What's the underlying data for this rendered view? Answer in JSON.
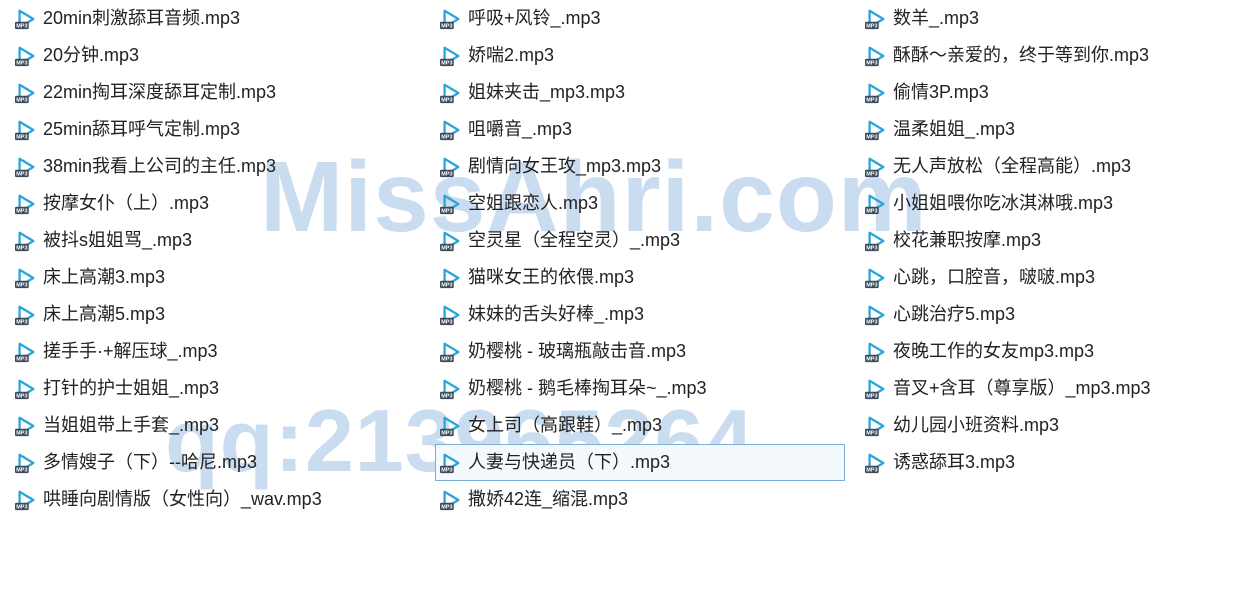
{
  "watermark": {
    "line1": "MissAhri.com",
    "line2": "qq:213965264"
  },
  "selected_name": "人妻与快递员（下）.mp3",
  "columns": [
    {
      "items": [
        {
          "name": "20min刺激舔耳音频.mp3"
        },
        {
          "name": "20分钟.mp3"
        },
        {
          "name": "22min掏耳深度舔耳定制.mp3"
        },
        {
          "name": "25min舔耳呼气定制.mp3"
        },
        {
          "name": "38min我看上公司的主任.mp3"
        },
        {
          "name": "按摩女仆（上）.mp3"
        },
        {
          "name": "被抖s姐姐骂_.mp3"
        },
        {
          "name": "床上高潮3.mp3"
        },
        {
          "name": "床上高潮5.mp3"
        },
        {
          "name": "搓手手·+解压球_.mp3"
        },
        {
          "name": "打针的护士姐姐_.mp3"
        },
        {
          "name": "当姐姐带上手套_.mp3"
        },
        {
          "name": "多情嫂子（下）--哈尼.mp3"
        },
        {
          "name": "哄睡向剧情版（女性向）_wav.mp3"
        }
      ]
    },
    {
      "items": [
        {
          "name": "呼吸+风铃_.mp3"
        },
        {
          "name": "娇喘2.mp3"
        },
        {
          "name": "姐妹夹击_mp3.mp3"
        },
        {
          "name": "咀嚼音_.mp3"
        },
        {
          "name": "剧情向女王攻_mp3.mp3"
        },
        {
          "name": "空姐跟恋人.mp3"
        },
        {
          "name": "空灵星（全程空灵）_.mp3"
        },
        {
          "name": "猫咪女王的依偎.mp3"
        },
        {
          "name": "妹妹的舌头好棒_.mp3"
        },
        {
          "name": "奶樱桃 - 玻璃瓶敲击音.mp3"
        },
        {
          "name": "奶樱桃 - 鹅毛棒掏耳朵~_.mp3"
        },
        {
          "name": "女上司（高跟鞋）_.mp3"
        },
        {
          "name": "人妻与快递员（下）.mp3"
        },
        {
          "name": "撒娇42连_缩混.mp3"
        }
      ]
    },
    {
      "items": [
        {
          "name": "数羊_.mp3"
        },
        {
          "name": "酥酥～亲爱的，终于等到你.mp3"
        },
        {
          "name": "偷情3P.mp3"
        },
        {
          "name": "温柔姐姐_.mp3"
        },
        {
          "name": "无人声放松（全程高能）.mp3"
        },
        {
          "name": "小姐姐喂你吃冰淇淋哦.mp3"
        },
        {
          "name": "校花兼职按摩.mp3"
        },
        {
          "name": "心跳，口腔音，啵啵.mp3"
        },
        {
          "name": "心跳治疗5.mp3"
        },
        {
          "name": "夜晚工作的女友mp3.mp3"
        },
        {
          "name": "音叉+含耳（尊享版）_mp3.mp3"
        },
        {
          "name": "幼儿园小班资料.mp3"
        },
        {
          "name": "诱惑舔耳3.mp3"
        }
      ]
    }
  ]
}
